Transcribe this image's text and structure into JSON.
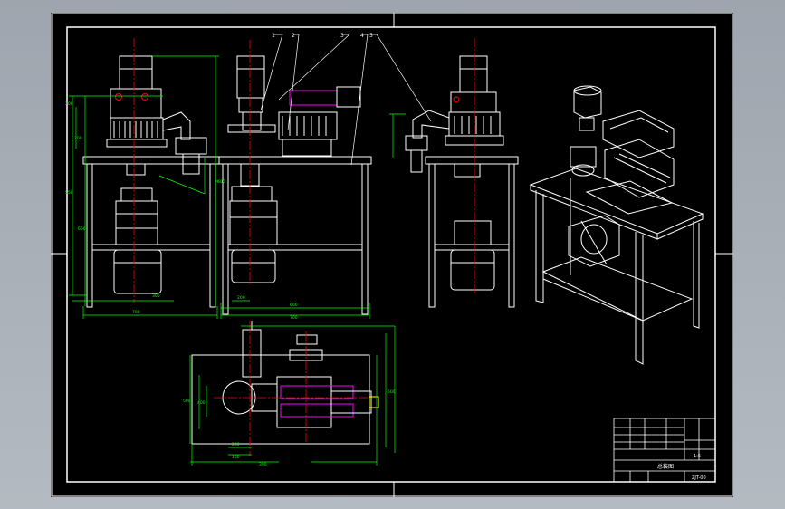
{
  "colors": {
    "background": "#a9b0b8",
    "sheet": "#000000",
    "frame": "#ffffff",
    "outline": "#ffffff",
    "dimension": "#00ff00",
    "centerline": "#ff0000",
    "leader": "#ffffff",
    "accent_magenta": "#ff00ff",
    "accent_yellow": "#ffff00"
  },
  "dimensions": {
    "front_view": [
      "200",
      "550",
      "650",
      "600",
      "700",
      "300",
      "200"
    ],
    "side_view": [
      "200",
      "600",
      "700"
    ],
    "top_view": [
      "500",
      "400",
      "600",
      "200",
      "150",
      "390"
    ]
  },
  "balloons": [
    "1",
    "2",
    "3",
    "4",
    "5"
  ],
  "title_block": {
    "drawing_name": "总装图",
    "scale": "1:5",
    "drawing_number": "ZJT-00"
  }
}
